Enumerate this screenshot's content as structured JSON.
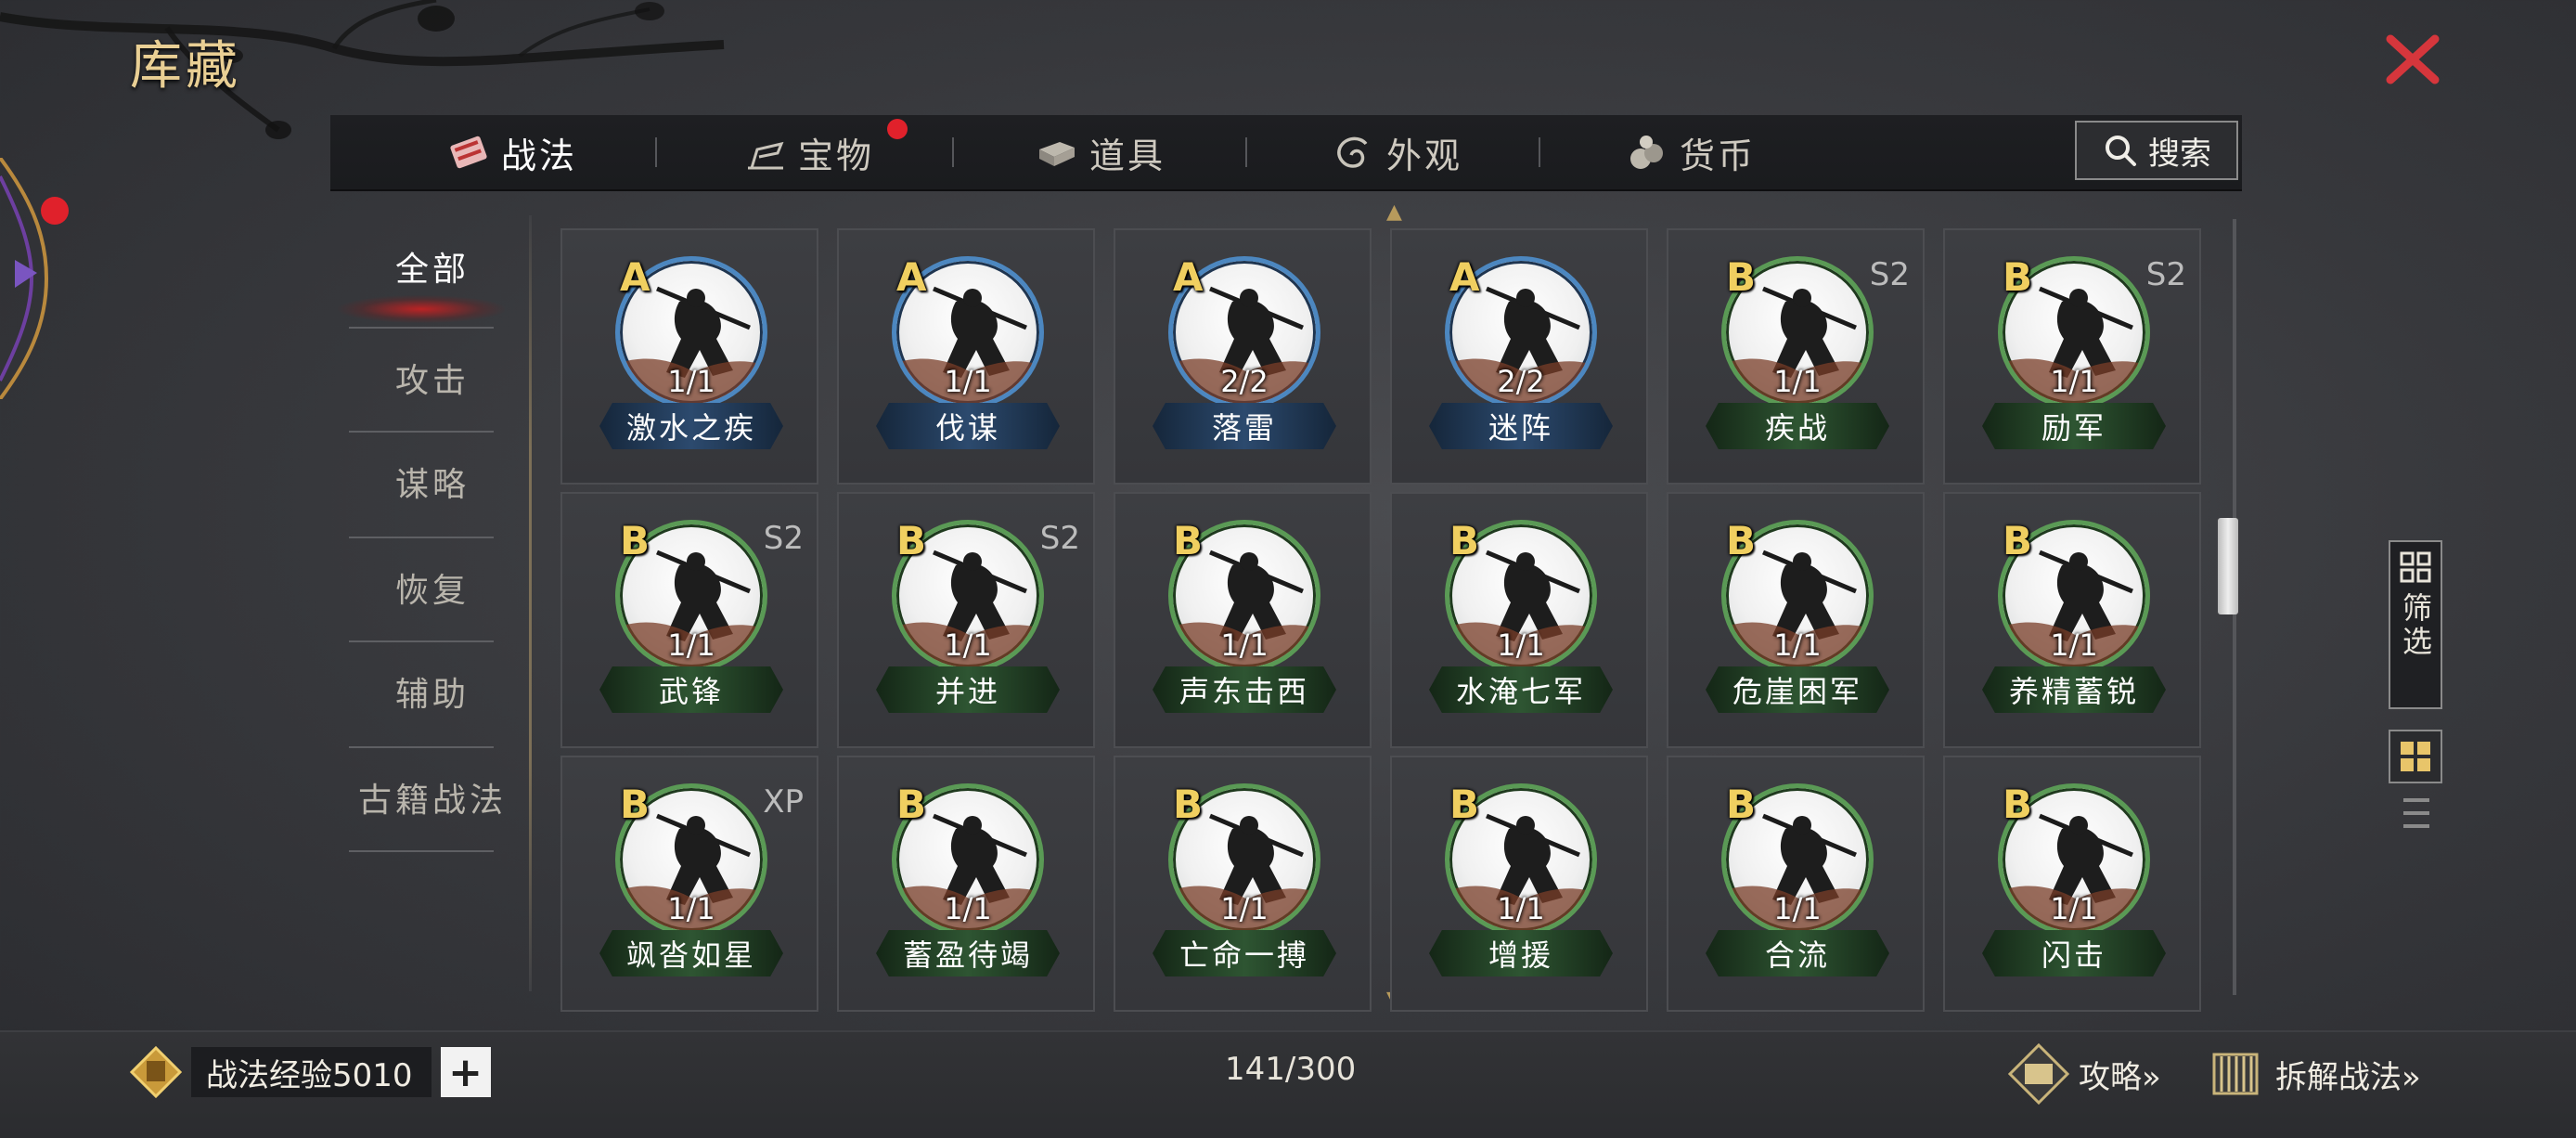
{
  "header": {
    "title": "库藏",
    "close_icon": "close-icon"
  },
  "tabs": [
    {
      "label": "战法",
      "icon": "scroll-icon",
      "active": true
    },
    {
      "label": "宝物",
      "icon": "treasure-icon",
      "badge": true
    },
    {
      "label": "道具",
      "icon": "book-icon"
    },
    {
      "label": "外观",
      "icon": "swirl-icon"
    },
    {
      "label": "货币",
      "icon": "coins-icon"
    }
  ],
  "search": {
    "label": "搜索",
    "icon": "search-icon"
  },
  "categories": [
    "全部",
    "攻击",
    "谋略",
    "恢复",
    "辅助",
    "古籍战法"
  ],
  "cards": [
    {
      "grade": "A",
      "count": "1/1",
      "name": "激水之疾",
      "season": "",
      "color": "blue"
    },
    {
      "grade": "A",
      "count": "1/1",
      "name": "伐谋",
      "season": "",
      "color": "blue"
    },
    {
      "grade": "A",
      "count": "2/2",
      "name": "落雷",
      "season": "",
      "color": "blue"
    },
    {
      "grade": "A",
      "count": "2/2",
      "name": "迷阵",
      "season": "",
      "color": "blue"
    },
    {
      "grade": "B",
      "count": "1/1",
      "name": "疾战",
      "season": "S2",
      "color": "green"
    },
    {
      "grade": "B",
      "count": "1/1",
      "name": "励军",
      "season": "S2",
      "color": "green"
    },
    {
      "grade": "B",
      "count": "1/1",
      "name": "武锋",
      "season": "S2",
      "color": "green"
    },
    {
      "grade": "B",
      "count": "1/1",
      "name": "并进",
      "season": "S2",
      "color": "green"
    },
    {
      "grade": "B",
      "count": "1/1",
      "name": "声东击西",
      "season": "",
      "color": "green"
    },
    {
      "grade": "B",
      "count": "1/1",
      "name": "水淹七军",
      "season": "",
      "color": "green"
    },
    {
      "grade": "B",
      "count": "1/1",
      "name": "危崖困军",
      "season": "",
      "color": "green"
    },
    {
      "grade": "B",
      "count": "1/1",
      "name": "养精蓄锐",
      "season": "",
      "color": "green"
    },
    {
      "grade": "B",
      "count": "1/1",
      "name": "飒沓如星",
      "season": "XP",
      "color": "green"
    },
    {
      "grade": "B",
      "count": "1/1",
      "name": "蓄盈待竭",
      "season": "",
      "color": "green"
    },
    {
      "grade": "B",
      "count": "1/1",
      "name": "亡命一搏",
      "season": "",
      "color": "green"
    },
    {
      "grade": "B",
      "count": "1/1",
      "name": "增援",
      "season": "",
      "color": "green"
    },
    {
      "grade": "B",
      "count": "1/1",
      "name": "合流",
      "season": "",
      "color": "green"
    },
    {
      "grade": "B",
      "count": "1/1",
      "name": "闪击",
      "season": "",
      "color": "green"
    }
  ],
  "side_controls": {
    "filter_label": "筛选",
    "filter_icon": "filter-grid-icon",
    "grid_view_icon": "grid-view-icon",
    "list_view_icon": "list-view-icon"
  },
  "footer": {
    "exp_label": "战法经验",
    "exp_value": "5010",
    "exp_text": "战法经验5010",
    "add_label": "+",
    "capacity": "141/300",
    "guide_label": "攻略»",
    "disassemble_label": "拆解战法»"
  },
  "colors": {
    "accent_gold": "#e9cf94",
    "close_red": "#d6363c",
    "badge_red": "#e0212b",
    "grade_yellow": "#f0cf60",
    "blue_rim": "#4c87c0",
    "green_rim": "#5a9a55"
  }
}
